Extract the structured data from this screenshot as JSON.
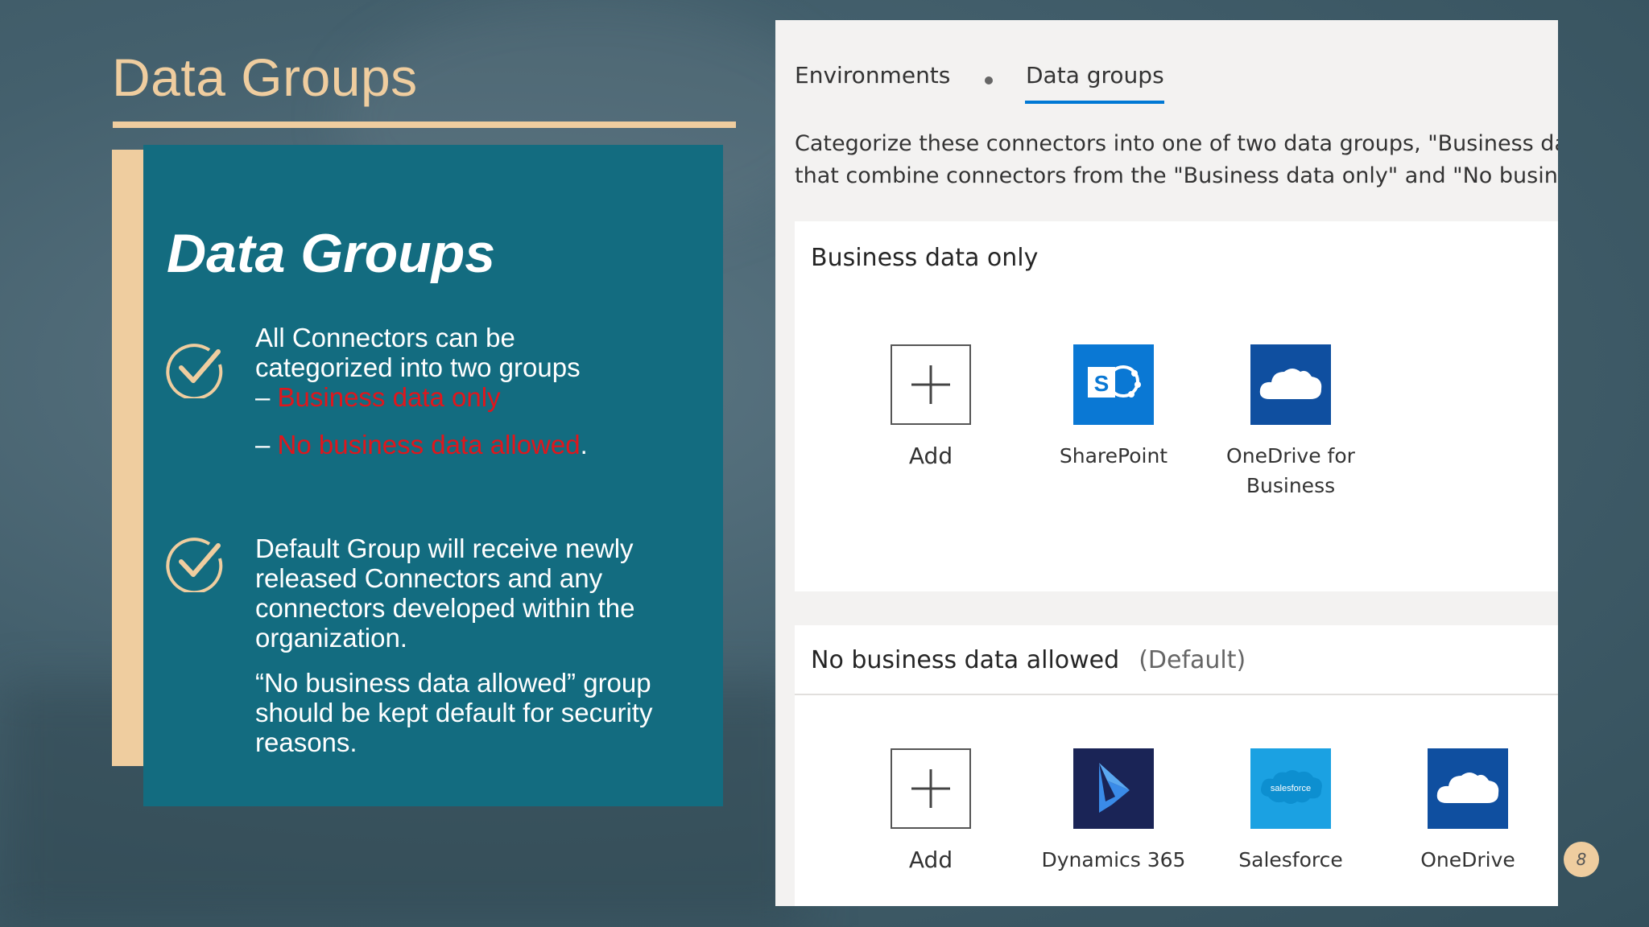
{
  "slide": {
    "title": "Data Groups",
    "page_number": "8"
  },
  "box": {
    "heading": "Data Groups",
    "bullet1": {
      "line1": "All Connectors can be",
      "line2": "categorized into two groups",
      "dash1_prefix": "– ",
      "dash1_red": "Business data only",
      "dash2_prefix": "– ",
      "dash2_red": "No business data allowed",
      "dash2_suffix": "."
    },
    "bullet2": {
      "text": "Default Group will receive newly released Connectors and any connectors developed within the organization."
    },
    "bullet3": {
      "text": "“No business data allowed” group should be kept default for security reasons."
    }
  },
  "panel": {
    "tabs": [
      {
        "label": "Environments"
      },
      {
        "label": "Data groups"
      }
    ],
    "description_line1": "Categorize these connectors into one of two data groups, \"Business data only",
    "description_line2": "that combine connectors from the \"Business data only\" and \"No business dat",
    "group1": {
      "title": "Business data only",
      "tiles": [
        {
          "label": "Add",
          "icon": "plus-icon"
        },
        {
          "label": "SharePoint",
          "icon": "sharepoint-icon"
        },
        {
          "label": "OneDrive for Business",
          "line1": "OneDrive for",
          "line2": "Business",
          "icon": "cloud-icon"
        }
      ]
    },
    "group2": {
      "title": "No business data allowed",
      "tag": "(Default)",
      "tiles": [
        {
          "label": "Add",
          "icon": "plus-icon"
        },
        {
          "label": "Dynamics 365",
          "icon": "dynamics-icon"
        },
        {
          "label": "Salesforce",
          "icon": "salesforce-icon",
          "logo_text": "salesforce"
        },
        {
          "label": "OneDrive",
          "icon": "cloud-icon"
        }
      ]
    }
  },
  "colors": {
    "accent": "#efcd9f",
    "teal": "#136c80",
    "red": "#e0161c",
    "tab_underline": "#0078d4",
    "sharepoint": "#0a78d4",
    "onedrive": "#0f4fa0",
    "dynamics": "#1a2456",
    "salesforce": "#1ba1e2"
  }
}
